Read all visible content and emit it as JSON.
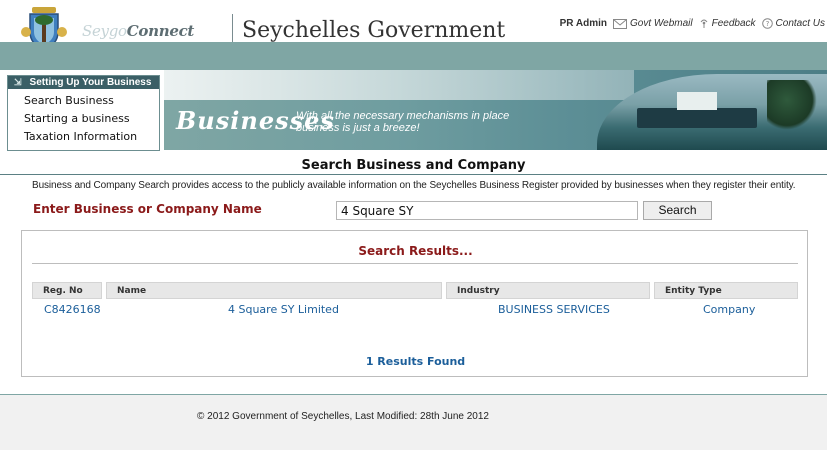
{
  "header": {
    "brand_light": "Seygo",
    "brand_strong": "Connect",
    "title": "Seychelles Government",
    "links": [
      {
        "label": "PR Admin",
        "icon": ""
      },
      {
        "label": "Govt Webmail",
        "icon": "mail-icon"
      },
      {
        "label": "Feedback",
        "icon": "feedback-icon"
      },
      {
        "label": "Contact Us",
        "icon": "help-icon"
      }
    ]
  },
  "sidebar": {
    "heading": "Setting Up Your Business",
    "items": [
      {
        "label": "Search Business"
      },
      {
        "label": "Starting a business"
      },
      {
        "label": "Taxation Information"
      }
    ]
  },
  "banner": {
    "title": "Businesses",
    "tagline_1": "With all the necessary mechanisms in place",
    "tagline_2": "business is just a breeze!"
  },
  "main": {
    "title": "Search Business and Company",
    "intro": "Business and Company Search provides access to the publicly available information on the Seychelles Business Register provided by businesses when they register their entity.",
    "search": {
      "label": "Enter Business or Company Name",
      "value": "4 Square SY",
      "button": "Search"
    },
    "results": {
      "heading": "Search Results...",
      "columns": [
        "Reg. No",
        "Name",
        "Industry",
        "Entity Type"
      ],
      "rows": [
        {
          "reg_no": "C8426168",
          "name": "4 Square SY Limited",
          "industry": "BUSINESS SERVICES",
          "entity_type": "Company"
        }
      ],
      "count": "1 Results Found"
    }
  },
  "footer": {
    "text": "© 2012 Government of Seychelles, Last Modified: 28th June 2012"
  },
  "colors": {
    "teal": "#7fa6a4",
    "dark_teal": "#3b5f66",
    "label_red": "#8b1a1a",
    "link_blue": "#1b5e9a"
  }
}
